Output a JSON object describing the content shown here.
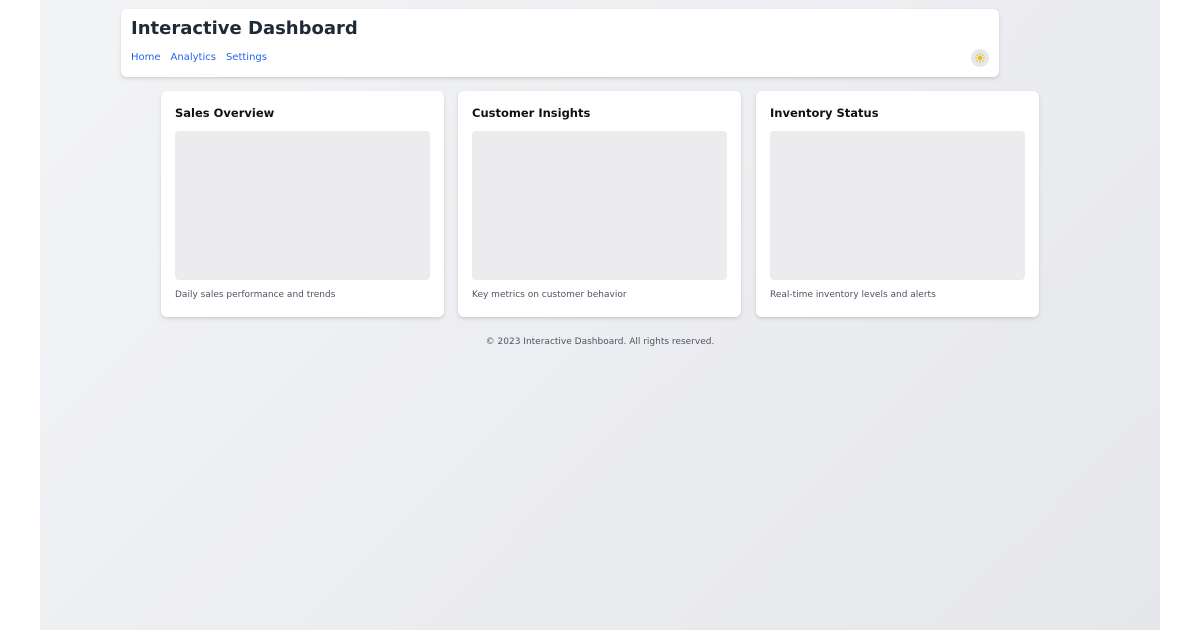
{
  "header": {
    "title": "Interactive Dashboard",
    "nav": [
      "Home",
      "Analytics",
      "Settings"
    ],
    "theme_toggle_icon": "sun-icon"
  },
  "cards": [
    {
      "title": "Sales Overview",
      "description": "Daily sales performance and trends"
    },
    {
      "title": "Customer Insights",
      "description": "Key metrics on customer behavior"
    },
    {
      "title": "Inventory Status",
      "description": "Real-time inventory levels and alerts"
    }
  ],
  "footer": {
    "text": "© 2023 Interactive Dashboard. All rights reserved."
  },
  "colors": {
    "accent": "#2563eb",
    "title_text": "#1f2937",
    "chart_placeholder": "#ececef",
    "sun": "#f2b705"
  }
}
